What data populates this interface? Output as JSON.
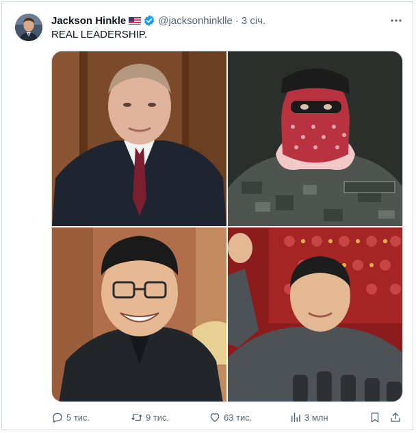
{
  "author": {
    "name": "Jackson Hinkle",
    "handle": "@jacksonhinklle",
    "separator": "·",
    "time": "3 січ."
  },
  "tweet": {
    "text": "REAL LEADERSHIP."
  },
  "media": {
    "panel_count": 4
  },
  "actions": {
    "replies": "5 тис.",
    "reposts": "9 тис.",
    "likes": "63 тис.",
    "views": "3 млн"
  },
  "colors": {
    "text_primary": "#0f1419",
    "text_secondary": "#536471",
    "verified_blue": "#1d9bf0",
    "border": "#cfd9de"
  },
  "icons": [
    "flag-icon",
    "verified-icon",
    "more-icon",
    "reply-icon",
    "repost-icon",
    "like-icon",
    "views-icon",
    "bookmark-icon",
    "share-icon"
  ]
}
